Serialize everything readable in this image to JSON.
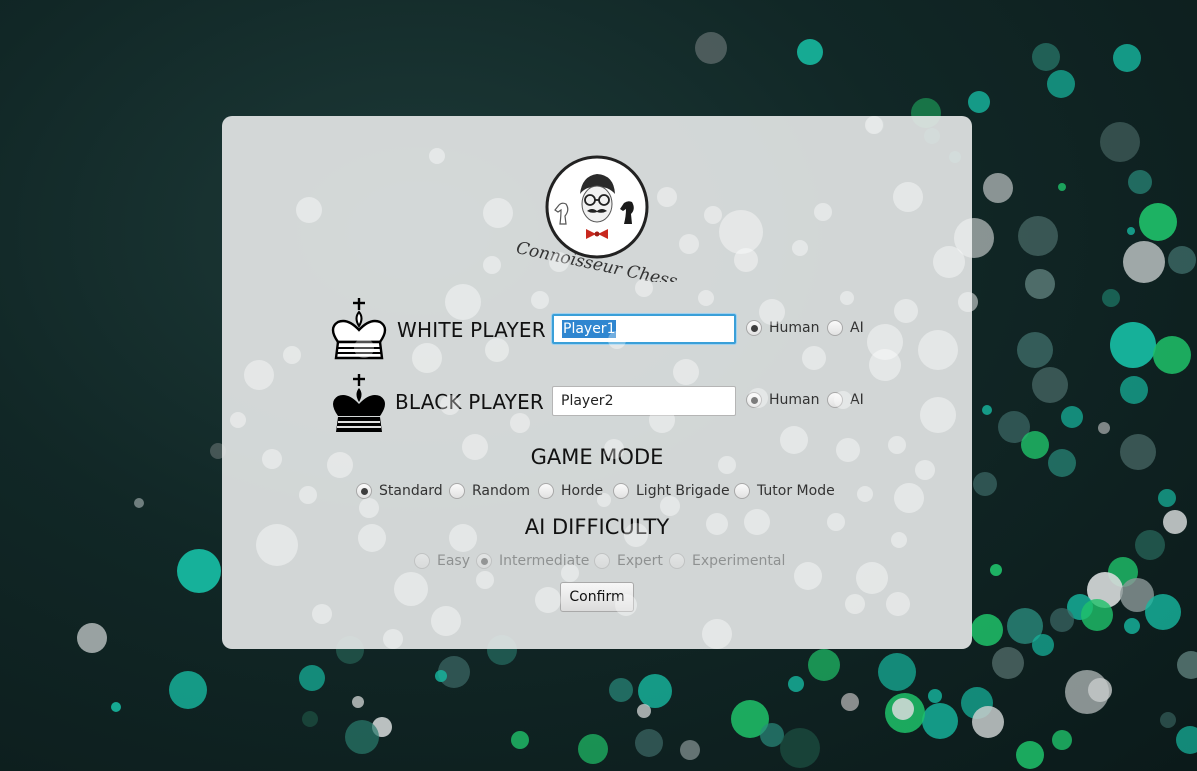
{
  "app": {
    "logo_text": "Connoisseur Chess"
  },
  "players": {
    "white": {
      "label": "WHITE PLAYER",
      "name": "Player1",
      "type_options": [
        "Human",
        "AI"
      ],
      "selected": "Human"
    },
    "black": {
      "label": "BLACK PLAYER",
      "name": "Player2",
      "type_options": [
        "Human",
        "AI"
      ],
      "selected": "Human"
    }
  },
  "game_mode": {
    "heading": "GAME MODE",
    "options": [
      "Standard",
      "Random",
      "Horde",
      "Light Brigade",
      "Tutor Mode"
    ],
    "selected": "Standard"
  },
  "ai_difficulty": {
    "heading": "AI DIFFICULTY",
    "options": [
      "Easy",
      "Intermediate",
      "Expert",
      "Experimental"
    ],
    "selected": "Intermediate",
    "enabled": false
  },
  "confirm_label": "Confirm",
  "colors": {
    "accent": "#3a9fd8",
    "panel": "#e6e8e8",
    "bokeh_teal": "#17b8a0",
    "bokeh_green": "#1fc26a"
  }
}
